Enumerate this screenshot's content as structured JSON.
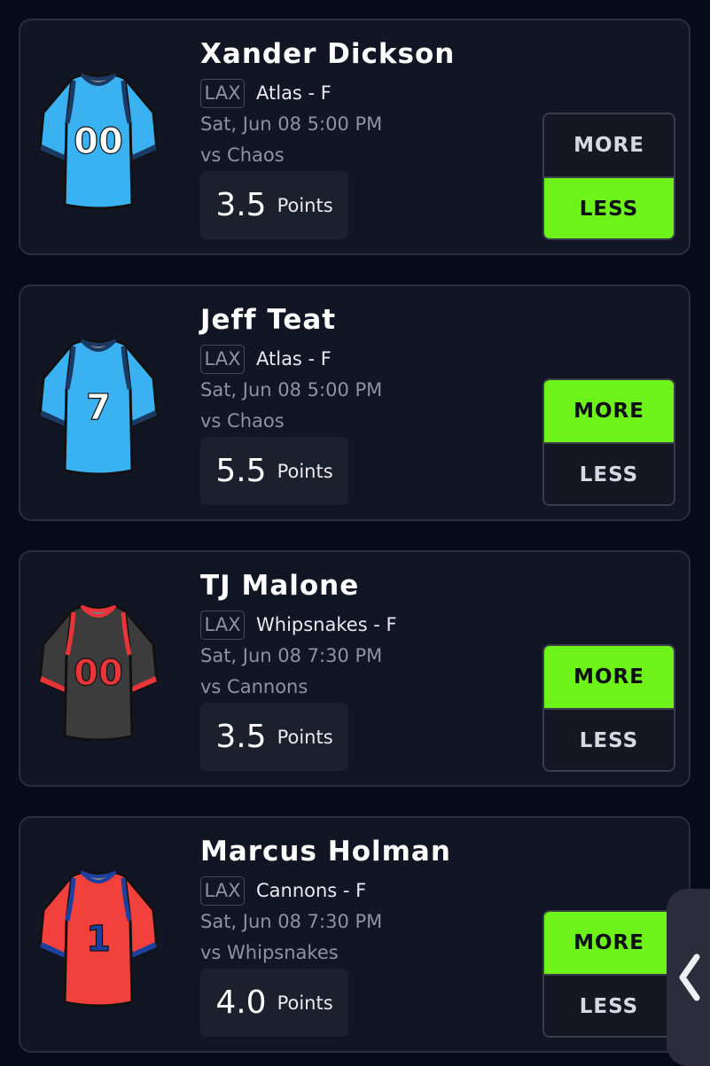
{
  "cards": [
    {
      "name": "Xander Dickson",
      "league": "LAX",
      "team_pos": "Atlas - F",
      "time": "Sat, Jun 08 5:00 PM",
      "opponent": "vs Chaos",
      "points_value": "3.5",
      "points_unit": "Points",
      "more_label": "MORE",
      "less_label": "LESS",
      "selected": "less",
      "jersey": {
        "number": "00",
        "body_color": "#3ab2f2",
        "trim_color": "#1b3a63",
        "number_color": "#ffffff"
      }
    },
    {
      "name": "Jeff Teat",
      "league": "LAX",
      "team_pos": "Atlas - F",
      "time": "Sat, Jun 08 5:00 PM",
      "opponent": "vs Chaos",
      "points_value": "5.5",
      "points_unit": "Points",
      "more_label": "MORE",
      "less_label": "LESS",
      "selected": "more",
      "jersey": {
        "number": "7",
        "body_color": "#3ab2f2",
        "trim_color": "#1b3a63",
        "number_color": "#ffffff"
      }
    },
    {
      "name": "TJ Malone",
      "league": "LAX",
      "team_pos": "Whipsnakes - F",
      "time": "Sat, Jun 08 7:30 PM",
      "opponent": "vs Cannons",
      "points_value": "3.5",
      "points_unit": "Points",
      "more_label": "MORE",
      "less_label": "LESS",
      "selected": "more",
      "jersey": {
        "number": "00",
        "body_color": "#3c3c3c",
        "trim_color": "#e8353a",
        "number_color": "#e8353a"
      }
    },
    {
      "name": "Marcus Holman",
      "league": "LAX",
      "team_pos": "Cannons - F",
      "time": "Sat, Jun 08 7:30 PM",
      "opponent": "vs Whipsnakes",
      "points_value": "4.0",
      "points_unit": "Points",
      "more_label": "MORE",
      "less_label": "LESS",
      "selected": "more",
      "jersey": {
        "number": "1",
        "body_color": "#f2403c",
        "trim_color": "#1d3f9e",
        "number_color": "#1d3f9e"
      }
    }
  ],
  "colors": {
    "page_bg": "#070a17",
    "card_bg": "#121523",
    "accent_green": "#6df31a"
  },
  "side_handle": {
    "icon": "chevron-left-icon"
  }
}
